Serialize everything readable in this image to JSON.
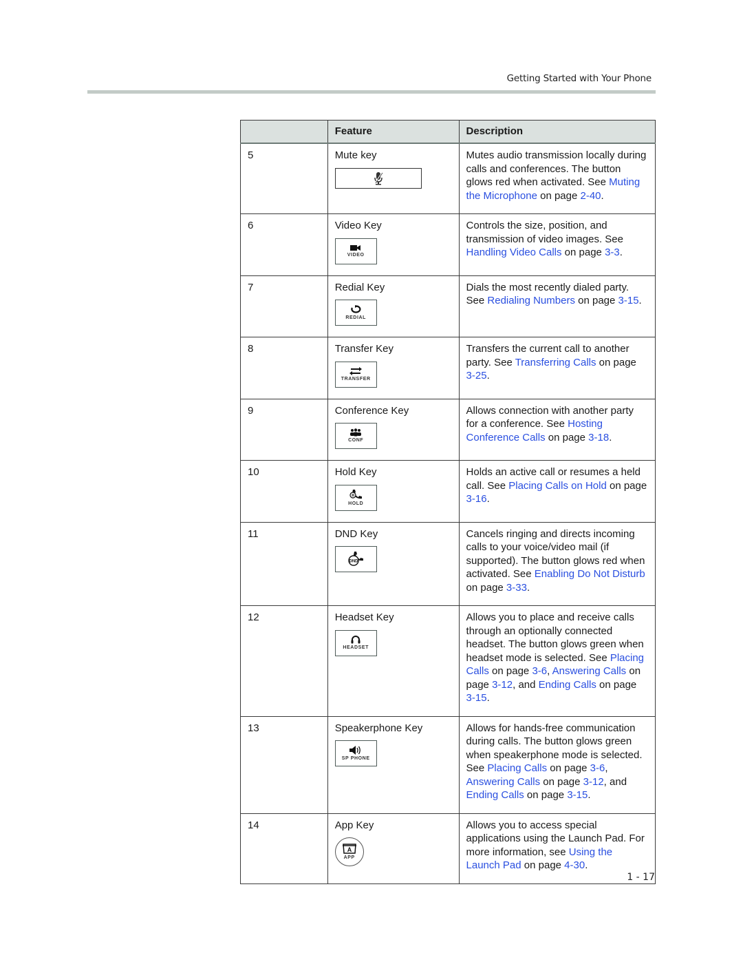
{
  "running_header": "Getting Started with Your Phone",
  "page_number": "1 - 17",
  "link_color": "#2a4fe0",
  "table": {
    "columns": [
      "",
      "Feature",
      "Description"
    ],
    "rows": [
      {
        "num": "5",
        "feature": "Mute key",
        "icon": "mute-microphone-icon",
        "key_label": "",
        "desc": [
          {
            "t": "Mutes audio transmission locally during calls and conferences. The button glows red when activated. See "
          },
          {
            "t": "Muting the Microphone",
            "link": true
          },
          {
            "t": " on page "
          },
          {
            "t": "2-40",
            "link": true
          },
          {
            "t": "."
          }
        ]
      },
      {
        "num": "6",
        "feature": "Video Key",
        "icon": "video-camera-icon",
        "key_label": "VIDEO",
        "desc": [
          {
            "t": "Controls the size, position, and transmission of video images. See "
          },
          {
            "t": "Handling Video Calls",
            "link": true
          },
          {
            "t": " on page "
          },
          {
            "t": "3-3",
            "link": true
          },
          {
            "t": "."
          }
        ]
      },
      {
        "num": "7",
        "feature": "Redial Key",
        "icon": "redial-icon",
        "key_label": "REDIAL",
        "desc": [
          {
            "t": "Dials the most recently dialed party. See "
          },
          {
            "t": "Redialing Numbers",
            "link": true
          },
          {
            "t": " on page "
          },
          {
            "t": "3-15",
            "link": true
          },
          {
            "t": "."
          }
        ]
      },
      {
        "num": "8",
        "feature": "Transfer Key",
        "icon": "transfer-arrows-icon",
        "key_label": "TRANSFER",
        "desc": [
          {
            "t": "Transfers the current call to another party. See "
          },
          {
            "t": "Transferring Calls",
            "link": true
          },
          {
            "t": " on page "
          },
          {
            "t": "3-25",
            "link": true
          },
          {
            "t": "."
          }
        ]
      },
      {
        "num": "9",
        "feature": "Conference Key",
        "icon": "conference-people-icon",
        "key_label": "CONF",
        "desc": [
          {
            "t": "Allows connection with another party for a conference. See "
          },
          {
            "t": "Hosting Conference Calls",
            "link": true
          },
          {
            "t": " on page "
          },
          {
            "t": "3-18",
            "link": true
          },
          {
            "t": "."
          }
        ]
      },
      {
        "num": "10",
        "feature": "Hold Key",
        "icon": "hold-handset-icon",
        "key_label": "HOLD",
        "desc": [
          {
            "t": "Holds an active call or resumes a held call. See "
          },
          {
            "t": "Placing Calls on Hold",
            "link": true
          },
          {
            "t": " on page "
          },
          {
            "t": "3-16",
            "link": true
          },
          {
            "t": "."
          }
        ]
      },
      {
        "num": "11",
        "feature": "DND Key",
        "icon": "dnd-handset-icon",
        "key_label": "",
        "desc": [
          {
            "t": "Cancels ringing and directs incoming calls to your voice/video mail (if supported). The button glows red when activated. See "
          },
          {
            "t": "Enabling Do Not Disturb",
            "link": true
          },
          {
            "t": " on page "
          },
          {
            "t": "3-33",
            "link": true
          },
          {
            "t": "."
          }
        ]
      },
      {
        "num": "12",
        "feature": "Headset Key",
        "icon": "headset-icon",
        "key_label": "HEADSET",
        "desc": [
          {
            "t": "Allows you to place and receive calls through an optionally connected headset. The button glows green when headset mode is selected. See "
          },
          {
            "t": "Placing Calls",
            "link": true
          },
          {
            "t": " on page "
          },
          {
            "t": "3-6",
            "link": true
          },
          {
            "t": ", "
          },
          {
            "t": "Answering Calls",
            "link": true
          },
          {
            "t": " on page "
          },
          {
            "t": "3-12",
            "link": true
          },
          {
            "t": ", and "
          },
          {
            "t": "Ending Calls",
            "link": true
          },
          {
            "t": " on page "
          },
          {
            "t": "3-15",
            "link": true
          },
          {
            "t": "."
          }
        ]
      },
      {
        "num": "13",
        "feature": "Speakerphone Key",
        "icon": "speaker-icon",
        "key_label": "SP PHONE",
        "desc": [
          {
            "t": "Allows for hands-free communication during calls. The button glows green when speakerphone mode is selected. See "
          },
          {
            "t": "Placing Calls",
            "link": true
          },
          {
            "t": " on page "
          },
          {
            "t": "3-6",
            "link": true
          },
          {
            "t": ", "
          },
          {
            "t": "Answering Calls",
            "link": true
          },
          {
            "t": " on page "
          },
          {
            "t": "3-12",
            "link": true
          },
          {
            "t": ", and "
          },
          {
            "t": "Ending Calls",
            "link": true
          },
          {
            "t": " on page "
          },
          {
            "t": "3-15",
            "link": true
          },
          {
            "t": "."
          }
        ]
      },
      {
        "num": "14",
        "feature": "App Key",
        "icon": "app-launchpad-icon",
        "key_label": "APP",
        "desc": [
          {
            "t": "Allows you to access special applications using the Launch Pad. For more information, see "
          },
          {
            "t": "Using the Launch Pad",
            "link": true
          },
          {
            "t": " on page "
          },
          {
            "t": "4-30",
            "link": true
          },
          {
            "t": "."
          }
        ]
      }
    ]
  }
}
